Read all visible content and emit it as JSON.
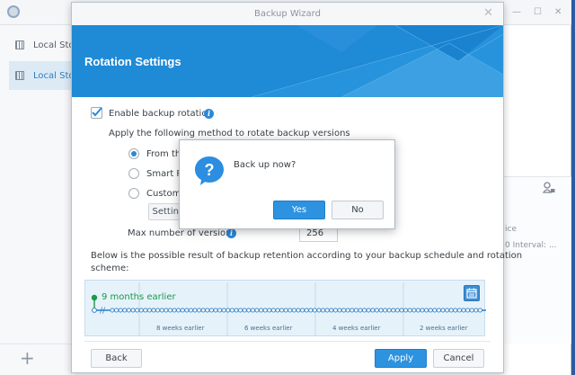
{
  "app": {
    "sidebar": {
      "items": [
        {
          "label": "Local Storage"
        },
        {
          "label": "Local Storage"
        }
      ]
    },
    "panel_lines": [
      "ice",
      "0 Interval: ..."
    ]
  },
  "wizard": {
    "title": "Backup Wizard",
    "heading": "Rotation Settings",
    "enable_rotation_label": "Enable backup rotation",
    "enable_rotation_checked": true,
    "method_prompt": "Apply the following method to rotate backup versions",
    "methods": [
      {
        "label": "From the earliest versions",
        "selected": true
      },
      {
        "label": "Smart Recycle",
        "selected": false
      },
      {
        "label": "Customized retention policy",
        "selected": false
      }
    ],
    "settings_button": "Settings",
    "max_versions_label": "Max number of versions",
    "max_versions_value": "256",
    "result_description_line1": "Below is the possible result of backup retention according to your backup schedule and rotation",
    "result_description_line2": "scheme:",
    "timeline": {
      "start_label": "9 months earlier",
      "ticks": [
        "8 weeks earlier",
        "6 weeks earlier",
        "4 weeks earlier",
        "2 weeks earlier"
      ]
    },
    "buttons": {
      "back": "Back",
      "apply": "Apply",
      "cancel": "Cancel"
    }
  },
  "popup": {
    "message": "Back up now?",
    "yes": "Yes",
    "no": "No"
  },
  "colors": {
    "header_blue": "#1f8ad6",
    "accent_blue": "#2d93e0",
    "timeline_green": "#1a9a47",
    "desktop_blue": "#2d5aa3"
  }
}
